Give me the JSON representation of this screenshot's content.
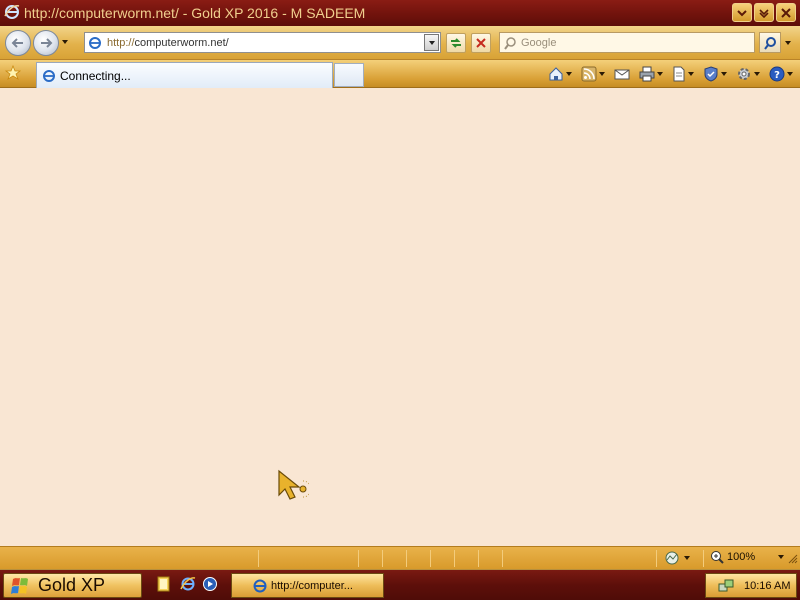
{
  "window": {
    "title": "http://computerworm.net/ - Gold XP 2016 - M SADEEM"
  },
  "address_bar": {
    "protocol": "http://",
    "host": "computerworm.net/"
  },
  "search": {
    "placeholder": "Google"
  },
  "tabs": [
    {
      "label": "Connecting..."
    }
  ],
  "command_bar": {
    "icons": [
      "home-icon",
      "feeds-icon",
      "mail-icon",
      "print-icon",
      "page-icon",
      "safety-icon",
      "tools-icon",
      "help-icon"
    ]
  },
  "status_bar": {
    "zoom": "100%"
  },
  "taskbar": {
    "start_label": "Gold XP",
    "task_label": "http://computer...",
    "clock": "10:16 AM"
  },
  "colors": {
    "title_bar": "#6f120c",
    "title_text": "#f0cf8e",
    "toolbar_gold": "#e3b24b",
    "content_bg": "#f9e6d3",
    "taskbar": "#5d0f0a"
  }
}
